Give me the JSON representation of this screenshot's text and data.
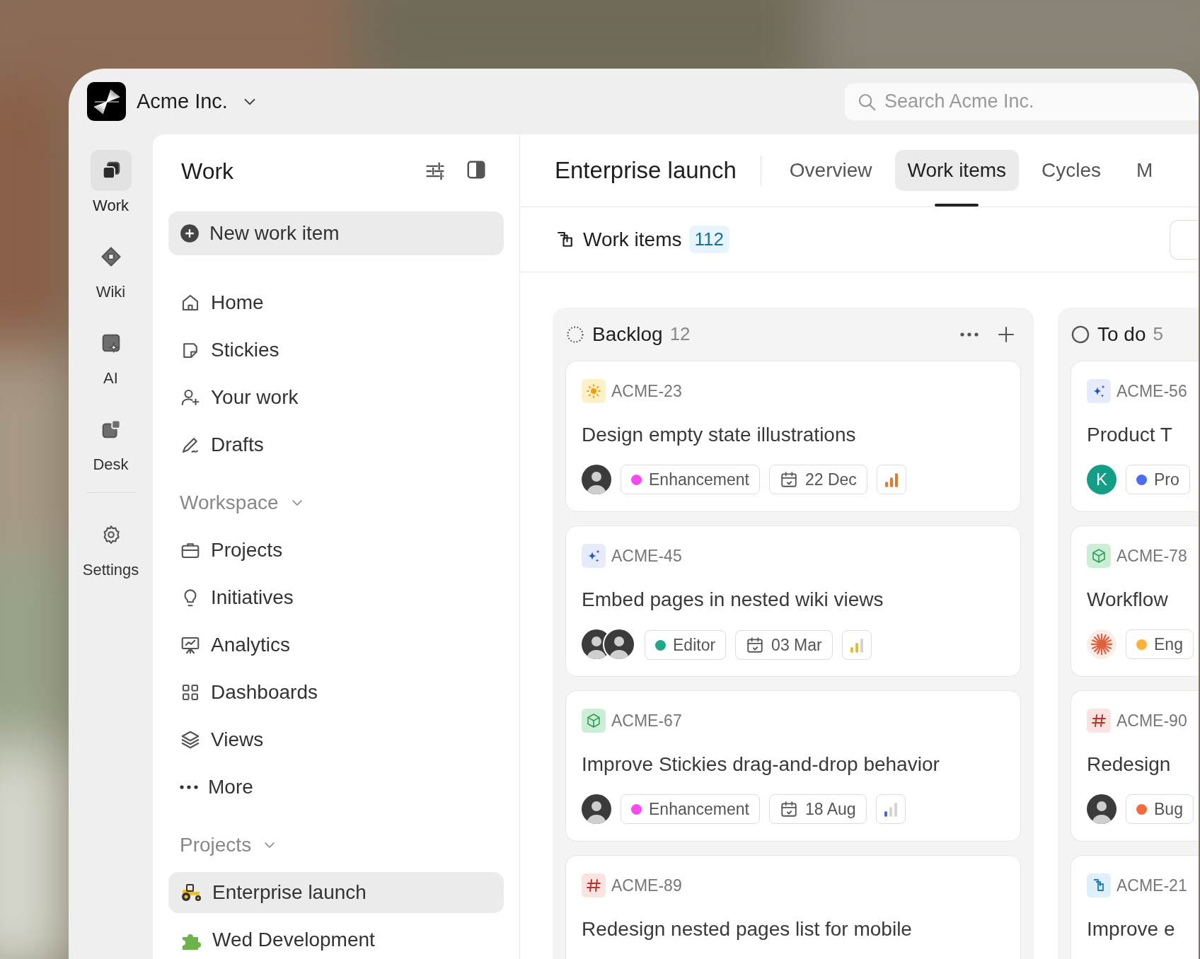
{
  "brand": {
    "name": "Acme Inc."
  },
  "search": {
    "placeholder": "Search Acme Inc."
  },
  "rail": {
    "apps": [
      {
        "label": "Work",
        "kind": "work",
        "selected": true
      },
      {
        "label": "Wiki",
        "kind": "wiki",
        "selected": false
      },
      {
        "label": "AI",
        "kind": "ai",
        "selected": false
      },
      {
        "label": "Desk",
        "kind": "desk",
        "selected": false
      }
    ],
    "bottom": [
      {
        "label": "Settings",
        "kind": "settings",
        "selected": false
      }
    ]
  },
  "sidebar": {
    "title": "Work",
    "new_button": "New work item",
    "nav": [
      {
        "label": "Home",
        "kind": "home",
        "selected": false
      },
      {
        "label": "Stickies",
        "kind": "sticky",
        "selected": false
      },
      {
        "label": "Your work",
        "kind": "user",
        "selected": false
      },
      {
        "label": "Drafts",
        "kind": "pen",
        "selected": false
      }
    ],
    "sections": [
      {
        "title": "Workspace",
        "items": [
          {
            "label": "Projects",
            "kind": "briefcase",
            "selected": false
          },
          {
            "label": "Initiatives",
            "kind": "bulb",
            "selected": false
          },
          {
            "label": "Analytics",
            "kind": "chart",
            "selected": false
          },
          {
            "label": "Dashboards",
            "kind": "grid",
            "selected": false
          },
          {
            "label": "Views",
            "kind": "layers",
            "selected": false
          },
          {
            "label": "More",
            "kind": "dots",
            "selected": false
          }
        ]
      },
      {
        "title": "Projects",
        "items": [
          {
            "label": "Enterprise launch",
            "kind": "tractor",
            "selected": true
          },
          {
            "label": "Wed Development",
            "kind": "puzzle",
            "selected": false
          }
        ]
      }
    ]
  },
  "project": {
    "title": "Enterprise launch",
    "tabs": [
      {
        "label": "Overview",
        "selected": false
      },
      {
        "label": "Work items",
        "selected": true
      },
      {
        "label": "Cycles",
        "selected": false
      },
      {
        "label": "M",
        "selected": false
      }
    ]
  },
  "toolbar": {
    "title": "Work items",
    "count": "112"
  },
  "board": {
    "columns": [
      {
        "name": "Backlog",
        "count": "12",
        "kind": "backlog",
        "show_actions": true,
        "cards": [
          {
            "id": "ACME-23",
            "kind": "sun",
            "title": "Design empty state illustrations",
            "assignees": [
              {
                "kind": "person"
              }
            ],
            "label": {
              "text": "Enhancement",
              "color": "#f54bf0"
            },
            "date": "22 Dec",
            "priority": {
              "kind": "high"
            }
          },
          {
            "id": "ACME-45",
            "kind": "sparkle",
            "title": "Embed pages in nested wiki views",
            "assignees": [
              {
                "kind": "person"
              },
              {
                "kind": "person"
              }
            ],
            "label": {
              "text": "Editor",
              "color": "#1ea88a"
            },
            "date": "03 Mar",
            "priority": {
              "kind": "medium"
            }
          },
          {
            "id": "ACME-67",
            "kind": "cube",
            "title": "Improve Stickies drag-and-drop behavior",
            "assignees": [
              {
                "kind": "person"
              }
            ],
            "label": {
              "text": "Enhancement",
              "color": "#f54bf0"
            },
            "date": "18 Aug",
            "priority": {
              "kind": "low"
            }
          },
          {
            "id": "ACME-89",
            "kind": "hash",
            "title": "Redesign nested pages list for mobile"
          }
        ]
      },
      {
        "name": "To do",
        "count": "5",
        "kind": "todo",
        "show_actions": false,
        "cards": [
          {
            "id": "ACME-56",
            "kind": "sparkle",
            "title": "Product T",
            "assignees": [
              {
                "kind": "initial",
                "text": "K"
              }
            ],
            "label": {
              "text": "Pro",
              "color": "#4a6cf7"
            }
          },
          {
            "id": "ACME-78",
            "kind": "cube",
            "title": "Workflow",
            "assignees": [
              {
                "kind": "burst"
              }
            ],
            "label": {
              "text": "Eng",
              "color": "#fbb23a"
            }
          },
          {
            "id": "ACME-90",
            "kind": "hash",
            "title": "Redesign",
            "assignees": [
              {
                "kind": "person"
              }
            ],
            "label": {
              "text": "Bug",
              "color": "#f86a3d"
            }
          },
          {
            "id": "ACME-21",
            "kind": "stack",
            "title": "Improve e"
          }
        ]
      }
    ]
  }
}
